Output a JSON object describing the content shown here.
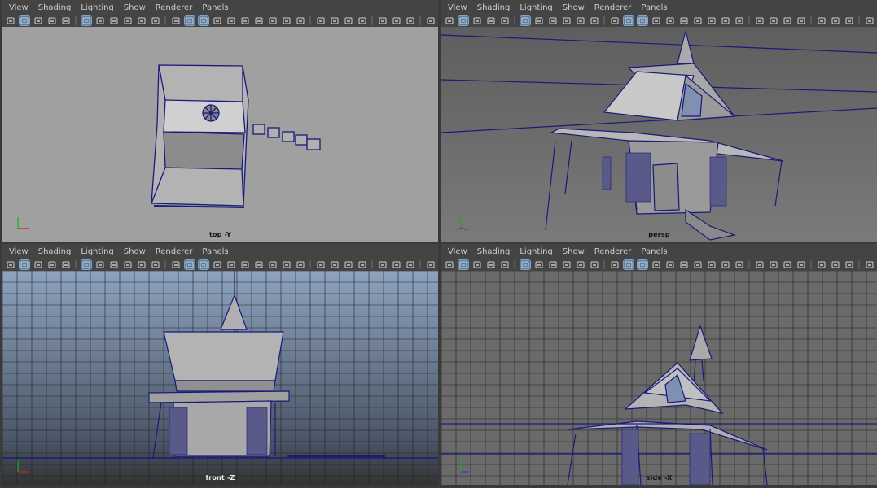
{
  "menus": [
    "View",
    "Shading",
    "Lighting",
    "Show",
    "Renderer",
    "Panels"
  ],
  "toolbar_icons": [
    "camera-icon",
    "camera-attr-icon",
    "bookmark-icon",
    "pencil-icon",
    "image-plane-icon",
    "grid-icon",
    "film-gate-icon",
    "resolution-gate-icon",
    "gate-mask-icon",
    "field-chart-icon",
    "safe-action-icon",
    "wireframe-icon",
    "smooth-shade-icon",
    "wireframe-on-shaded-icon",
    "xray-icon",
    "isolate-icon",
    "lights-icon",
    "shadows-icon",
    "ambient-occlusion-icon",
    "motion-blur-icon",
    "anti-alias-icon",
    "depth-of-field-icon",
    "isolate-select-icon",
    "xray-joints-icon",
    "xray-active-icon",
    "ui-icon",
    "frame-all-icon",
    "frame-selected-icon",
    "resolution-icon"
  ],
  "viewports": [
    {
      "label": "top -Y",
      "bg": "#a0a0a0"
    },
    {
      "label": "persp",
      "bg": "#6b6b6b"
    },
    {
      "label": "front -Z",
      "bg": "#7d90a8"
    },
    {
      "label": "side -X",
      "bg": "#6a6a6a"
    }
  ],
  "colors": {
    "wire": "#1a1a7a",
    "grid": "#222222",
    "accent": "#5a7fa3"
  }
}
